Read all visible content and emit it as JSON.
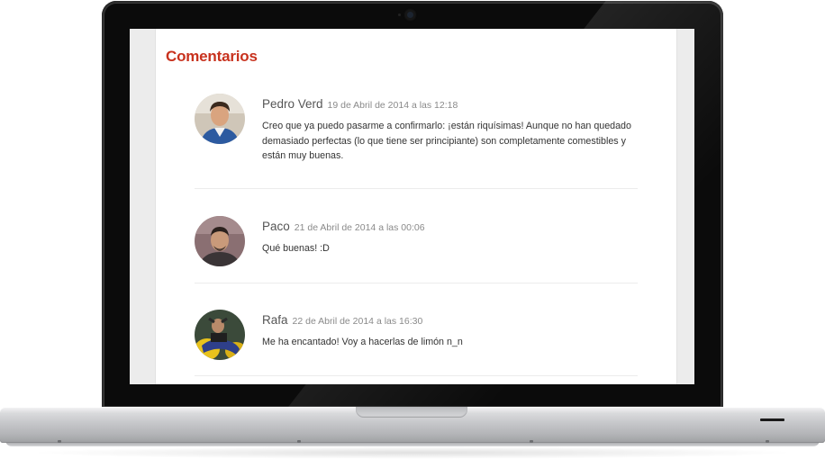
{
  "section": {
    "title": "Comentarios"
  },
  "comments": [
    {
      "author": "Pedro Verd",
      "date": "19 de Abril de 2014 a las 12:18",
      "text": "Creo que ya puedo pasarme a confirmarlo: ¡están riquísimas! Aunque no han quedado demasiado perfectas (lo que tiene ser principiante) son completamente comestibles y están muy buenas."
    },
    {
      "author": "Paco",
      "date": "21 de Abril de 2014 a las 00:06",
      "text": "Qué buenas! :D"
    },
    {
      "author": "Rafa",
      "date": "22 de Abril de 2014 a las 16:30",
      "text": "Me ha encantado! Voy a hacerlas de limón n_n"
    }
  ],
  "colors": {
    "accent": "#c8321e",
    "author": "#555555",
    "date": "#8a8a8a",
    "body_text": "#333333",
    "bezel": "#0b0b0b"
  },
  "icons": [
    "avatar-pedro",
    "avatar-paco",
    "avatar-rafa",
    "webcam-icon"
  ]
}
